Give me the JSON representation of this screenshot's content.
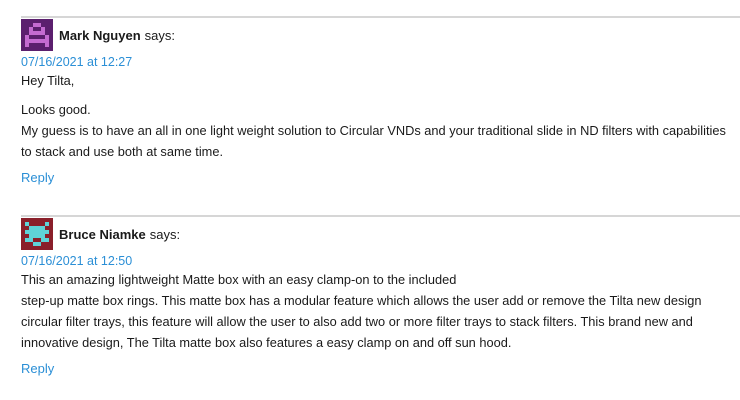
{
  "comments": [
    {
      "author": "Mark Nguyen",
      "says": "says:",
      "date": "07/16/2021 at 12:27",
      "paragraphs": [
        "Hey Tilta,",
        "Looks good.",
        "My guess is to have an all in one light weight solution to Circular VNDs and your traditional slide in ND filters with capabilities to stack and use both at same time."
      ],
      "reply": "Reply",
      "avatar_colors": {
        "bg": "#5b1f6e",
        "fg": "#c46bd1"
      }
    },
    {
      "author": "Bruce Niamke",
      "says": "says:",
      "date": "07/16/2021 at 12:50",
      "paragraphs": [
        "This an amazing lightweight Matte box with an easy clamp-on to the included",
        "step-up matte box rings. This matte box has a modular feature which allows the user add or remove the Tilta new design circular filter trays, this feature will allow the user to also add two or more filter trays to stack filters. This brand new and innovative design, The Tilta matte box also features a easy clamp on and off sun hood."
      ],
      "reply": "Reply",
      "avatar_colors": {
        "bg": "#8a1f2a",
        "fg": "#5fd3d8"
      }
    }
  ],
  "colors": {
    "link": "#2b8fd6",
    "divider": "#d6d6d6",
    "text": "#1a1a1a"
  }
}
